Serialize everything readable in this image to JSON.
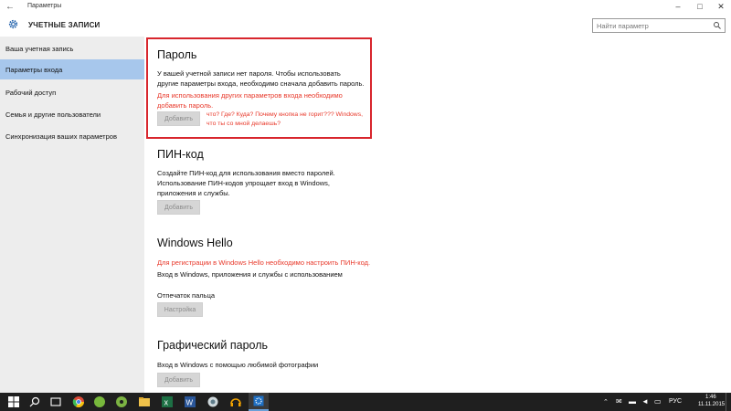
{
  "window": {
    "title": "Параметры"
  },
  "header": {
    "title": "УЧЕТНЫЕ ЗАПИСИ"
  },
  "search": {
    "placeholder": "Найти параметр"
  },
  "sidebar": {
    "items": [
      {
        "label": "Ваша учетная запись"
      },
      {
        "label": "Параметры входа"
      },
      {
        "label": "Рабочий доступ"
      },
      {
        "label": "Семья и другие пользователи"
      },
      {
        "label": "Синхронизация ваших параметров"
      }
    ]
  },
  "password": {
    "title": "Пароль",
    "line1": "У вашей учетной записи нет пароля. Чтобы использовать",
    "line2": "другие параметры входа, необходимо сначала добавить пароль.",
    "warn1": "Для использования других параметров входа необходимо",
    "warn2": "добавить пароль.",
    "button": "Добавить",
    "note1": "что? Где? Куда? Почему кнопка не горит??? Windows,",
    "note2": "что ты со мной делаешь?"
  },
  "pin": {
    "title": "ПИН-код",
    "line1": "Создайте ПИН-код для использования вместо паролей.",
    "line2": "Использование ПИН-кодов упрощает вход в Windows,",
    "line3": "приложения и службы.",
    "button": "Добавить"
  },
  "hello": {
    "title": "Windows Hello",
    "warn": "Для регистрации в Windows Hello необходимо настроить ПИН-код.",
    "line1": "Вход в Windows, приложения и службы с использованием",
    "fingerprint": "Отпечаток пальца",
    "button": "Настройка"
  },
  "picture": {
    "title": "Графический пароль",
    "line1": "Вход в Windows с помощью любимой фотографии",
    "button": "Добавить"
  },
  "taskbar": {
    "lang": "РУС",
    "time": "1:46",
    "date": "11.11.2015"
  },
  "colors": {
    "accent": "#a7c7ec",
    "warning": "#e8382a",
    "highlight_box": "#d8262d",
    "taskbar": "#1f1f1f"
  }
}
